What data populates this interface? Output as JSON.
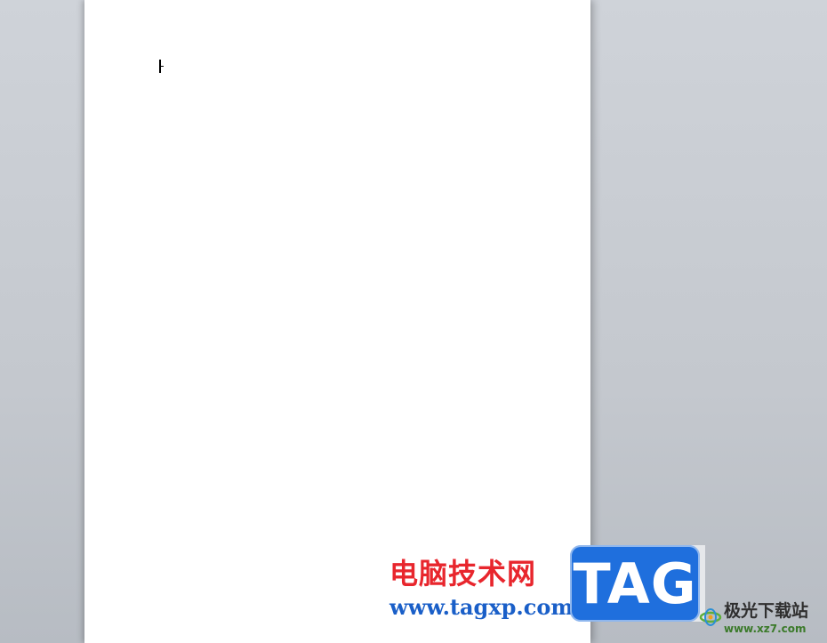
{
  "document": {
    "text_cursor_visible": true
  },
  "watermarks": {
    "site_name": "电脑技术网",
    "site_url": "www.tagxp.com",
    "tag_badge": "TAG",
    "secondary_name": "极光下载站",
    "secondary_url": "www.xz7.com",
    "colors": {
      "site_name": "#e8262d",
      "site_url": "#1a5fc8",
      "tag_badge_bg": "#1f6fdd",
      "secondary_url": "#3b7a2a"
    }
  }
}
